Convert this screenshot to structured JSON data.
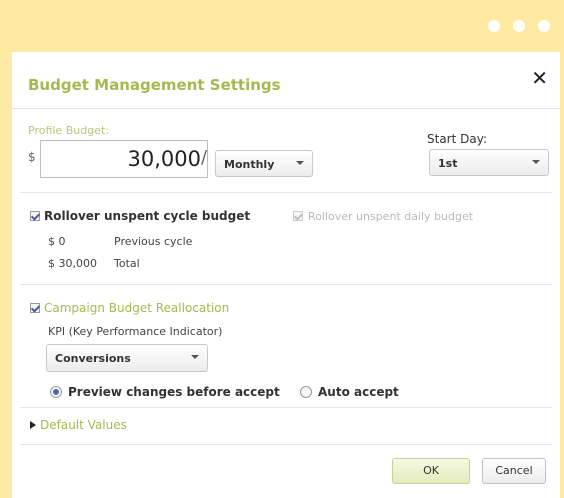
{
  "window": {
    "controls": [
      "dot",
      "dot",
      "dot"
    ]
  },
  "dialog": {
    "title": "Budget Management Settings",
    "close_glyph": "✕"
  },
  "budget": {
    "label": "Profile Budget:",
    "currency": "$",
    "amount": "30,000",
    "slash": "/",
    "period": "Monthly",
    "start_day_label": "Start Day:",
    "start_day": "1st"
  },
  "rollover": {
    "cycle_label": "Rollover unspent cycle budget",
    "cycle_checked": true,
    "daily_label": "Rollover unspent daily budget",
    "daily_checked": true,
    "daily_disabled": true,
    "rows": [
      {
        "amount": "$ 0",
        "desc": "Previous cycle"
      },
      {
        "amount": "$ 30,000",
        "desc": "Total"
      }
    ]
  },
  "reallocation": {
    "label": "Campaign Budget Reallocation",
    "checked": true,
    "kpi_label": "KPI (Key Performance Indicator)",
    "kpi_value": "Conversions",
    "radio_preview": "Preview changes before accept",
    "radio_auto": "Auto accept",
    "selected": "preview"
  },
  "defaults": {
    "label": "Default Values"
  },
  "buttons": {
    "ok": "OK",
    "cancel": "Cancel"
  },
  "colors": {
    "frame": "#fde9a1",
    "accent_green": "#a8b84e",
    "radio_selected": "#4a6aa8"
  }
}
